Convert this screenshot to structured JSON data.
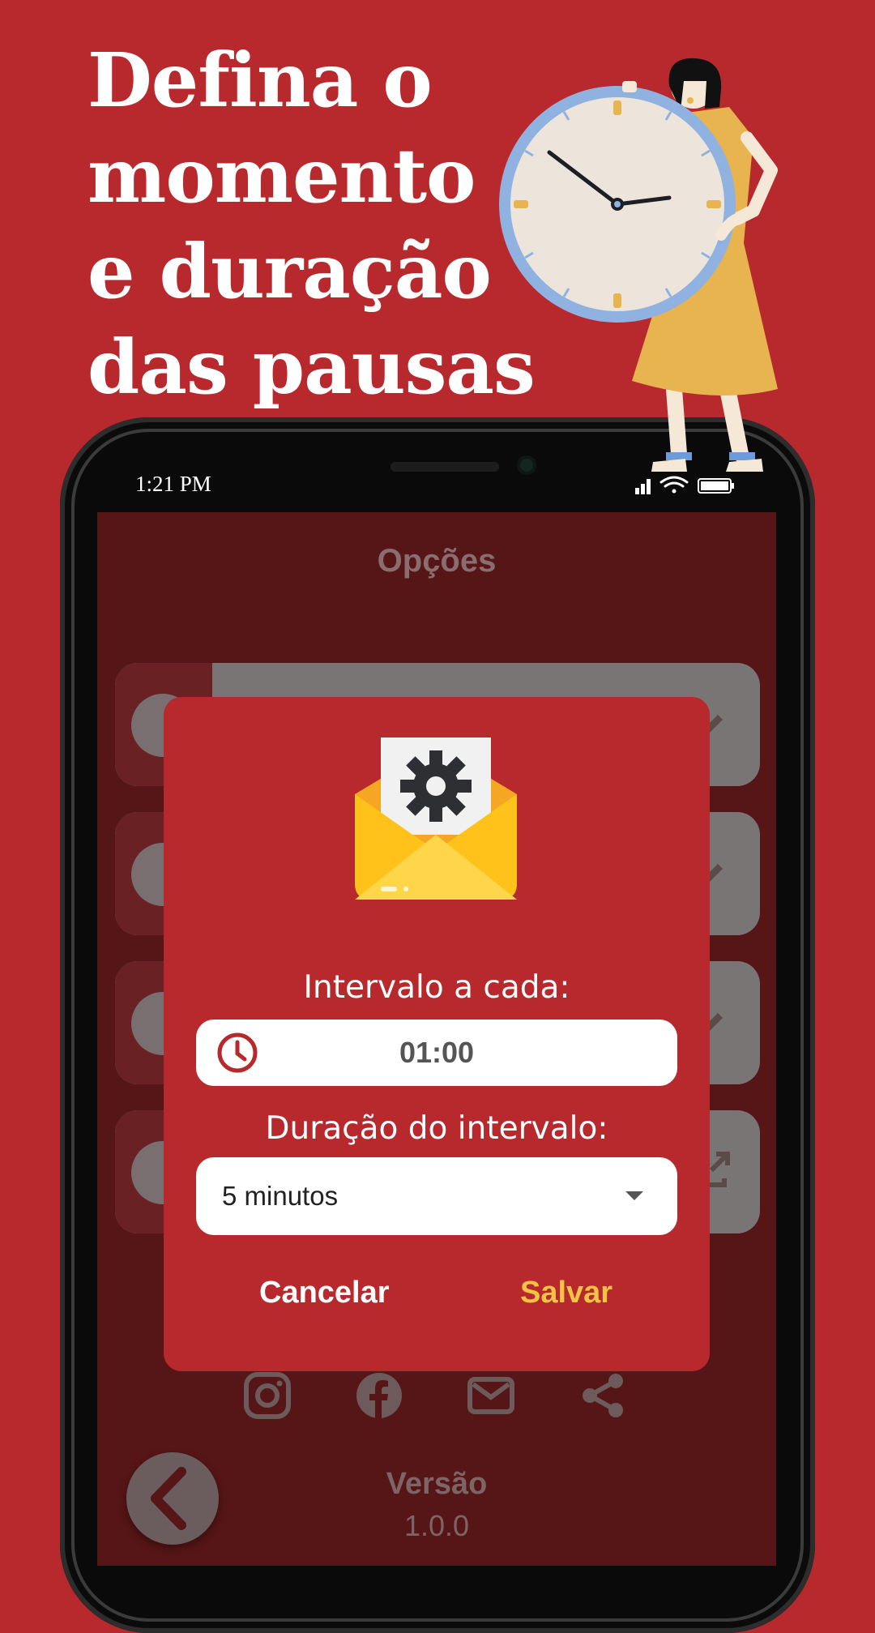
{
  "headline": {
    "line1": "Defina o",
    "line2": "momento",
    "line3": "e duração",
    "line4": "das pausas"
  },
  "status_bar": {
    "time": "1:21 PM"
  },
  "screen": {
    "title": "Opções",
    "version_label": "Versão",
    "version_value": "1.0.0",
    "social_icons": [
      "instagram-icon",
      "facebook-icon",
      "mail-icon",
      "share-icon"
    ]
  },
  "dialog": {
    "interval_label": "Intervalo a cada:",
    "interval_value": "01:00",
    "duration_label": "Duração do intervalo:",
    "duration_selected": "5 minutos",
    "cancel_label": "Cancelar",
    "save_label": "Salvar"
  },
  "colors": {
    "background": "#b7292c",
    "save_accent": "#f4c246",
    "clock_icon": "#b7292c"
  }
}
